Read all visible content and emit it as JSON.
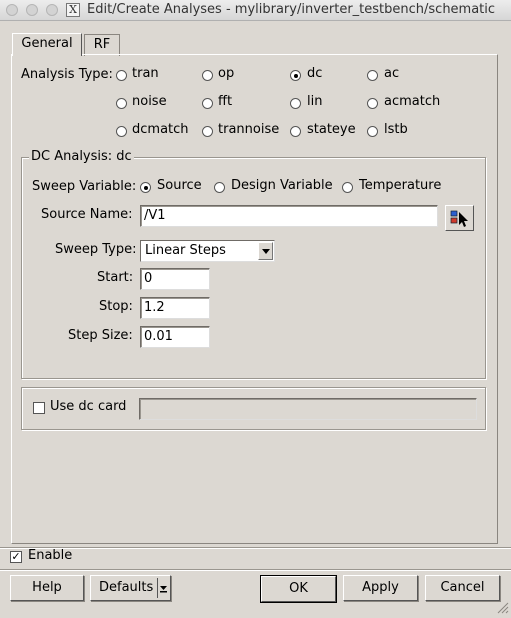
{
  "window": {
    "title": "Edit/Create Analyses - mylibrary/inverter_testbench/schematic",
    "app_icon_glyph": "X"
  },
  "tabs": [
    {
      "label": "General",
      "active": true
    },
    {
      "label": "RF",
      "active": false
    }
  ],
  "analysis_type": {
    "label": "Analysis Type:",
    "options": [
      "tran",
      "op",
      "dc",
      "ac",
      "noise",
      "fft",
      "lin",
      "acmatch",
      "dcmatch",
      "trannoise",
      "stateye",
      "lstb"
    ],
    "selected": "dc"
  },
  "dc_analysis": {
    "group_title": "DC Analysis: dc",
    "sweep_variable": {
      "label": "Sweep Variable:",
      "options": [
        "Source",
        "Design Variable",
        "Temperature"
      ],
      "selected": "Source"
    },
    "source_name": {
      "label": "Source Name:",
      "value": "/V1"
    },
    "sweep_type": {
      "label": "Sweep Type:",
      "value": "Linear Steps"
    },
    "start": {
      "label": "Start:",
      "value": "0"
    },
    "stop": {
      "label": "Stop:",
      "value": "1.2"
    },
    "step_size": {
      "label": "Step Size:",
      "value": "0.01"
    }
  },
  "dc_card": {
    "label": "Use dc card",
    "checked": false,
    "value": ""
  },
  "enable": {
    "label": "Enable",
    "checked": true,
    "mark": "✓"
  },
  "buttons": {
    "help": "Help",
    "defaults": "Defaults",
    "ok": "OK",
    "apply": "Apply",
    "cancel": "Cancel"
  }
}
